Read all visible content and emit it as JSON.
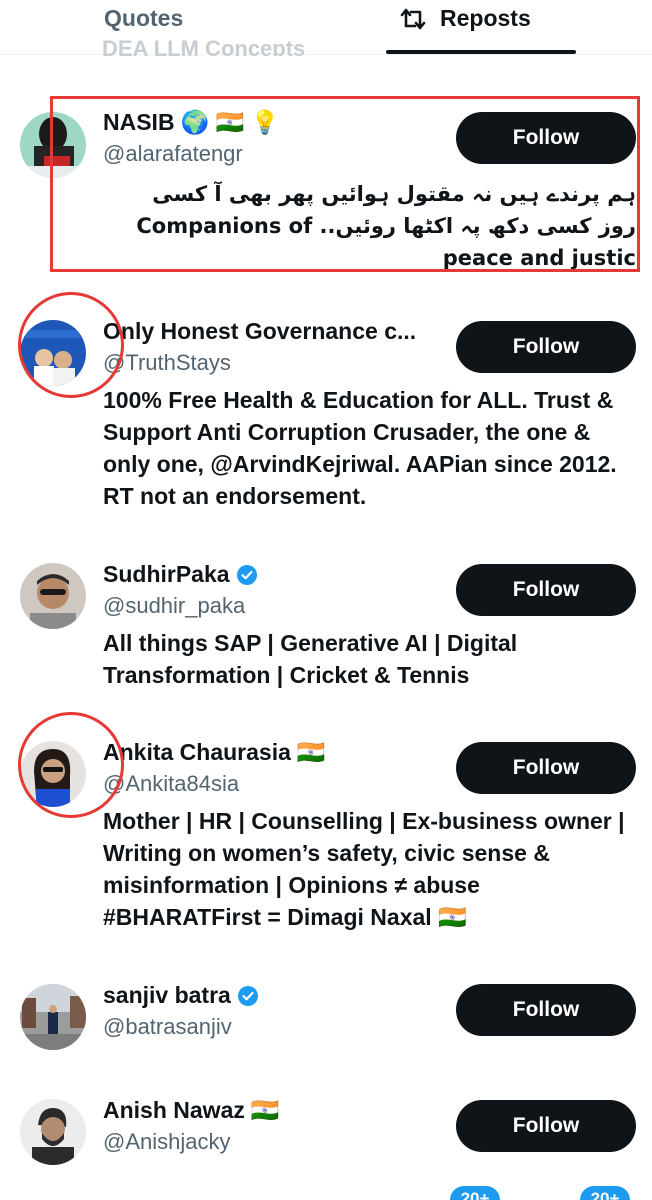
{
  "tabs": {
    "quotes": "Quotes",
    "reposts": "Reposts"
  },
  "ghost_text": "DEA LLM Concepts",
  "follow_label": "Follow",
  "users": [
    {
      "name": "NASIB",
      "name_suffix": "🌍 🇮🇳 💡",
      "handle": "@alarafatengr",
      "bio_lines": [
        "ہم پرندے ہیں نہ مقتول ہوائیں پھر بھی آ کسی",
        "روز کسی دکھ پہ اکٹھا روئیں.. Companions of",
        "peace and justic"
      ]
    },
    {
      "name": "Only Honest Governance c...",
      "handle": "@TruthStays",
      "bio": "100% Free Health & Education for ALL. Trust & Support Anti Corruption Crusader, the one & only one, @ArvindKejriwal. AAPian since 2012. RT not an endorsement."
    },
    {
      "name": "SudhirPaka",
      "verified": true,
      "handle": "@sudhir_paka",
      "bio": "All things SAP | Generative AI | Digital Transformation | Cricket & Tennis"
    },
    {
      "name": "Ankita Chaurasia",
      "name_suffix": "🇮🇳",
      "handle": "@Ankita84sia",
      "bio": "Mother | HR | Counselling | Ex-business owner | Writing on women’s safety, civic sense & misinformation | Opinions ≠ abuse #BHARATFirst = Dimagi Naxal 🇮🇳"
    },
    {
      "name": "sanjiv batra",
      "verified": true,
      "handle": "@batrasanjiv"
    },
    {
      "name": "Anish Nawaz",
      "name_suffix": "🇮🇳",
      "handle": "@Anishjacky"
    }
  ],
  "bottom_badges": [
    "20+",
    "20+"
  ],
  "colors": {
    "accent": "#1d9bf0",
    "highlight": "#e53935",
    "button": "#0f1419"
  }
}
